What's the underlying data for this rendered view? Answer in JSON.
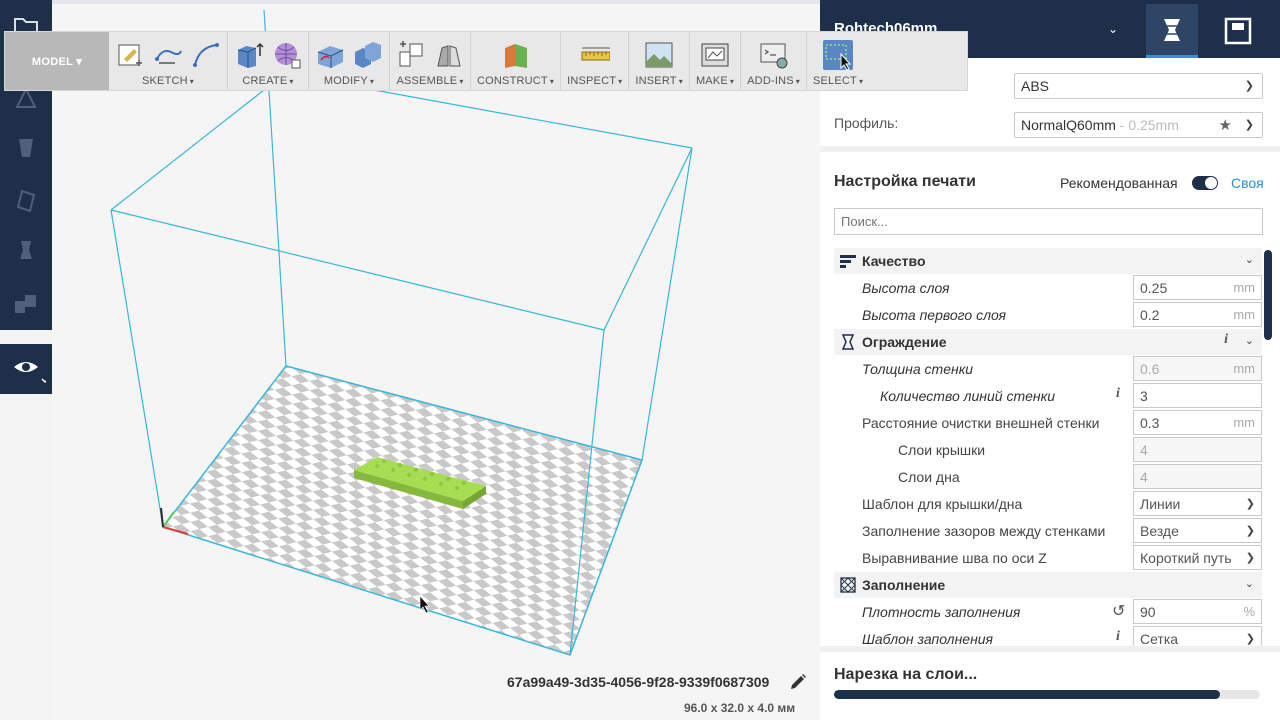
{
  "toolbar": {
    "mode": "MODEL ▾",
    "groups": [
      {
        "id": "sketch",
        "label": "SKETCH"
      },
      {
        "id": "create",
        "label": "CREATE"
      },
      {
        "id": "modify",
        "label": "MODIFY"
      },
      {
        "id": "assemble",
        "label": "ASSEMBLE"
      },
      {
        "id": "construct",
        "label": "CONSTRUCT"
      },
      {
        "id": "inspect",
        "label": "INSPECT"
      },
      {
        "id": "insert",
        "label": "INSERT"
      },
      {
        "id": "make",
        "label": "MAKE"
      },
      {
        "id": "addins",
        "label": "ADD-INS"
      },
      {
        "id": "select",
        "label": "SELECT"
      }
    ],
    "caret": "▾"
  },
  "header": {
    "printer_name": "Rohtech06mm",
    "caret": "⌄"
  },
  "material": {
    "value": "ABS"
  },
  "profile": {
    "label": "Профиль:",
    "name": "NormalQ60mm",
    "detail": " - 0.25mm"
  },
  "settings": {
    "title": "Настройка печати",
    "recommended": "Рекомендованная",
    "custom": "Своя",
    "search_placeholder": "Поиск...",
    "categories": {
      "quality": "Качество",
      "shell": "Ограждение",
      "infill": "Заполнение"
    },
    "rows": {
      "layer_height": {
        "label": "Высота слоя",
        "value": "0.25",
        "unit": "mm"
      },
      "first_layer_height": {
        "label": "Высота первого слоя",
        "value": "0.2",
        "unit": "mm"
      },
      "wall_thickness": {
        "label": "Толщина стенки",
        "value": "0.6",
        "unit": "mm"
      },
      "wall_line_count": {
        "label": "Количество линий стенки",
        "value": "3"
      },
      "outer_wall_wipe": {
        "label": "Расстояние очистки внешней стенки",
        "value": "0.3",
        "unit": "mm"
      },
      "top_layers": {
        "label": "Слои крышки",
        "value": "4"
      },
      "bottom_layers": {
        "label": "Слои дна",
        "value": "4"
      },
      "top_bottom_pattern": {
        "label": "Шаблон для крышки/дна",
        "value": "Линии"
      },
      "fill_gaps": {
        "label": "Заполнение зазоров между стенками",
        "value": "Везде"
      },
      "z_seam": {
        "label": "Выравнивание шва по оси Z",
        "value": "Короткий путь"
      },
      "infill_density": {
        "label": "Плотность заполнения",
        "value": "90",
        "unit": "%"
      },
      "infill_pattern": {
        "label": "Шаблон заполнения",
        "value": "Сетка"
      }
    },
    "info_glyph": "i",
    "reset_glyph": "↺"
  },
  "slicing": {
    "title": "Нарезка на слои...",
    "progress": 0.905
  },
  "object": {
    "name": "67a99a49-3d35-4056-9f28-9339f0687309",
    "dimensions": "96.0 x 32.0 x 4.0 мм"
  },
  "colors": {
    "dark_navy": "#1e2f4a",
    "accent_blue": "#2a8dd4",
    "model_green": "#a6dd52",
    "volume_cyan": "#38b6d8"
  }
}
